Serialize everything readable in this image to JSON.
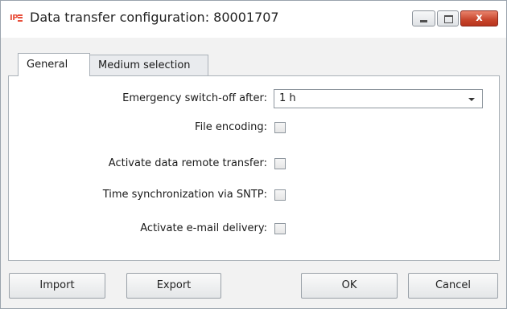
{
  "window": {
    "title": "Data transfer configuration: 80001707",
    "app_icon_text": "IP",
    "close_glyph": "x"
  },
  "tabs": [
    {
      "label": "General",
      "selected": true
    },
    {
      "label": "Medium selection",
      "selected": false
    }
  ],
  "form": {
    "emergency_label": "Emergency switch-off after:",
    "emergency_value": "1 h",
    "file_encoding_label": "File encoding:",
    "remote_transfer_label": "Activate data remote transfer:",
    "sntp_label": "Time synchronization via SNTP:",
    "email_label": "Activate e-mail delivery:",
    "checkboxes": {
      "file_encoding": false,
      "remote_transfer": false,
      "sntp": false,
      "email": false
    }
  },
  "buttons": {
    "import": "Import",
    "export": "Export",
    "ok": "OK",
    "cancel": "Cancel"
  },
  "colors": {
    "close_button": "#c7452c",
    "app_icon": "#e8503c",
    "window_bg": "#f2f2f2"
  }
}
